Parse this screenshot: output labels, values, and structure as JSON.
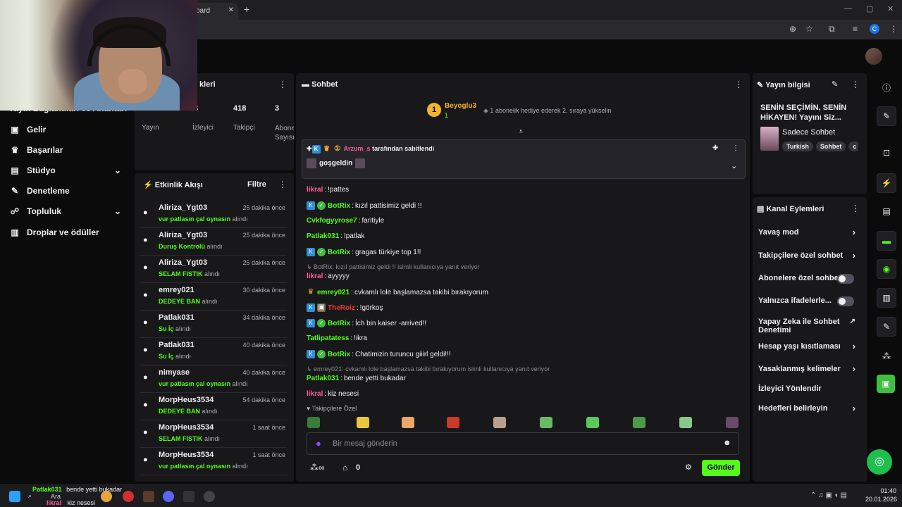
{
  "browser": {
    "tab_title": "oard",
    "new_tab": "+"
  },
  "left_nav": {
    "partial_item": "Yayın Bağlantıları ve Anahtarı",
    "items": [
      {
        "label": "Gelir",
        "icon": "dollar-icon"
      },
      {
        "label": "Başarılar",
        "icon": "trophy-icon"
      },
      {
        "label": "Stüdyo",
        "icon": "studio-icon",
        "expand": true
      },
      {
        "label": "Denetleme",
        "icon": "wrench-icon"
      },
      {
        "label": "Topluluk",
        "icon": "community-icon",
        "expand": true
      },
      {
        "label": "Droplar ve ödüller",
        "icon": "gift-icon"
      }
    ]
  },
  "stats_panel": {
    "title": "kleri",
    "live_badge": "",
    "stats": [
      {
        "value": "",
        "label": "Yayın"
      },
      {
        "value": "3",
        "label": "İzleyici"
      },
      {
        "value": "418",
        "label": "Takipçi"
      },
      {
        "value": "3",
        "label": "Abone Sayısı"
      }
    ]
  },
  "activity": {
    "title": "Etkinlik Akışı",
    "filter": "Filtre",
    "items": [
      {
        "user": "Aliriza_Ygt03",
        "time": "25 dakika önce",
        "reward": "vur patlasın çal oynasın",
        "suffix": "alındı"
      },
      {
        "user": "Aliriza_Ygt03",
        "time": "25 dakika önce",
        "reward": "Duruş Kontrolü",
        "suffix": "alındı"
      },
      {
        "user": "Aliriza_Ygt03",
        "time": "25 dakika önce",
        "reward": "SELAM FISTIK",
        "suffix": "alındı"
      },
      {
        "user": "emrey021",
        "time": "30 dakika önce",
        "reward": "DEDEYE BAN",
        "suffix": "alındı"
      },
      {
        "user": "Patlak031",
        "time": "34 dakika önce",
        "reward": "Su İç",
        "suffix": "alındı"
      },
      {
        "user": "Patlak031",
        "time": "40 dakika önce",
        "reward": "Su İç",
        "suffix": "alındı"
      },
      {
        "user": "nimyase",
        "time": "40 dakika önce",
        "reward": "vur patlasın çal oynasın",
        "suffix": "alındı"
      },
      {
        "user": "MorpHeus3534",
        "time": "54 dakika önce",
        "reward": "DEDEYE BAN",
        "suffix": "alındı"
      },
      {
        "user": "MorpHeus3534",
        "time": "1 saat önce",
        "reward": "SELAM FISTIK",
        "suffix": "alındı"
      },
      {
        "user": "MorpHeus3534",
        "time": "1 saat önce",
        "reward": "vur patlasın çal oynasın",
        "suffix": "alındı"
      }
    ]
  },
  "chat": {
    "title": "Sohbet",
    "leader": {
      "rank": "1",
      "name": "Beyoglu3",
      "count": "1",
      "message": "1 abonelik hediye ederek 2. sıraya yükselin"
    },
    "pinned": {
      "by_user": "Arzum_s",
      "by_suffix": "tarafından sabitlendi",
      "message": "goşgeldin"
    },
    "messages": [
      {
        "user": "likral",
        "color": "#ff5e94",
        "text": "!pattes",
        "badges": []
      },
      {
        "user": "BotRix",
        "color": "#53fc18",
        "text": "kızıl pattisimiz geldi !!",
        "badges": [
          "k",
          "v"
        ]
      },
      {
        "user": "Cvkfogyyrose7",
        "color": "#53fc18",
        "text": "faritiyle",
        "badges": []
      },
      {
        "user": "Patlak031",
        "color": "#53fc18",
        "text": "!patlak",
        "badges": []
      },
      {
        "user": "BotRix",
        "color": "#53fc18",
        "text": "gragas türkiye top 1!!",
        "badges": [
          "k",
          "v"
        ]
      },
      {
        "user": "likral",
        "color": "#ff5e94",
        "text": "ayyyyy",
        "badges": [],
        "reply": "BotRix: kızıl pattisimiz geldi !! isimli kullanıcıya yanıt veriyor"
      },
      {
        "user": "emrey021",
        "color": "#53fc18",
        "text": "cvkamlı lole başlamazsa takibi bırakıyorum",
        "badges": [
          "c"
        ]
      },
      {
        "user": "TheRoiz",
        "color": "#e53935",
        "text": "!görkoş",
        "badges": [
          "k",
          "i"
        ]
      },
      {
        "user": "BotRix",
        "color": "#53fc18",
        "text": "İch bin kaiser -arrived!!",
        "badges": [
          "k",
          "v"
        ]
      },
      {
        "user": "Tatlipatatess",
        "color": "#53fc18",
        "text": "!ikra",
        "badges": []
      },
      {
        "user": "BotRix",
        "color": "#53fc18",
        "text": "Chatimizin turuncu giiirl geldi!!!",
        "badges": [
          "k",
          "v"
        ]
      },
      {
        "user": "Patlak031",
        "color": "#53fc18",
        "text": "bende yetti bukadar",
        "badges": [],
        "reply": "emrey021: cvkamlı lole başlamazsa takibi bırakıyorum isimli kullanıcıya yanıt veriyor"
      },
      {
        "user": "likral",
        "color": "#ff5e94",
        "text": "kiz nesesi",
        "badges": []
      }
    ],
    "followers_only": "Takipçilere Özel",
    "input_placeholder": "Bir mesaj gönderin",
    "points_value": "0",
    "send_label": "Gönder"
  },
  "stream_info": {
    "title": "Yayın bilgisi",
    "stream_title": "SENİN SEÇİMİN, SENİN HİKAYEN! Yayını Siz...",
    "category": "Sadece Sohbet",
    "tags": [
      "Turkish",
      "Sohbet",
      "c"
    ]
  },
  "channel_actions": {
    "title": "Kanal Eylemleri",
    "rows": [
      {
        "label": "Yavaş mod",
        "control": "chevron"
      },
      {
        "label": "Takipçilere özel sohbet",
        "control": "chevron"
      },
      {
        "label": "Abonelere özel sohbet",
        "control": "toggle"
      },
      {
        "label": "Yalnızca ifadelerle...",
        "control": "toggle"
      },
      {
        "label": "Yapay Zeka ile Sohbet Denetimi",
        "control": "external"
      },
      {
        "label": "Hesap yaşı kısıtlaması",
        "control": "chevron"
      },
      {
        "label": "Yasaklanmış kelimeler",
        "control": "chevron"
      },
      {
        "label": "İzleyici Yönlendir",
        "control": "none"
      },
      {
        "label": "Hedefleri belirleyin",
        "control": "chevron"
      }
    ]
  },
  "taskbar": {
    "search": "Ara",
    "notif_user1": "Patlak031",
    "notif_msg1": "bende yetti bukadar",
    "notif_user2": "likral",
    "notif_msg2": "kiz nesesi",
    "time": "01:40",
    "date": "20.01.2026"
  },
  "colors": {
    "accent": "#53fc18",
    "panel": "#18181b",
    "bg": "#0b0b0c"
  }
}
